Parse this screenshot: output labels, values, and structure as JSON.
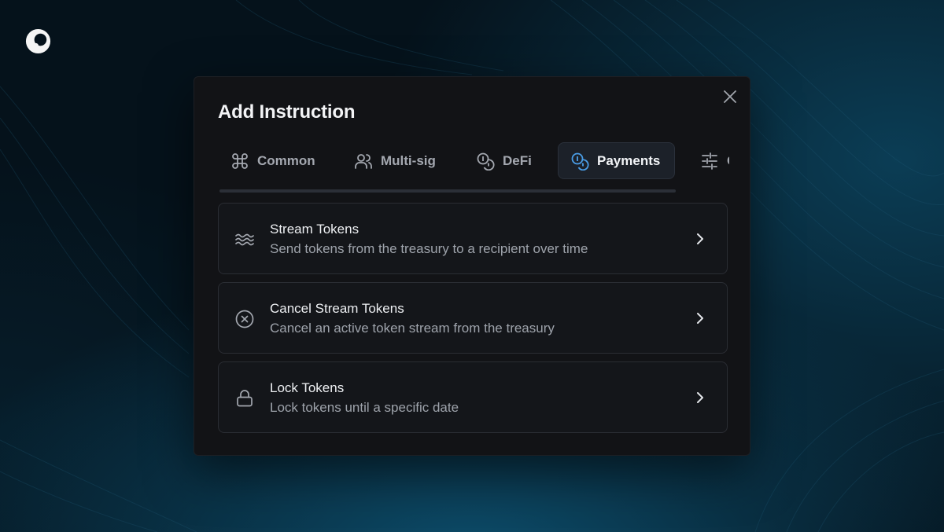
{
  "modal": {
    "title": "Add Instruction",
    "close_icon": "close-icon"
  },
  "tabs": [
    {
      "label": "Common",
      "icon": "command-icon",
      "active": false
    },
    {
      "label": "Multi-sig",
      "icon": "users-icon",
      "active": false
    },
    {
      "label": "DeFi",
      "icon": "coins-icon",
      "active": false
    },
    {
      "label": "Payments",
      "icon": "coins-icon",
      "active": true
    },
    {
      "label": "C",
      "icon": "sliders-icon",
      "active": false
    }
  ],
  "items": [
    {
      "title": "Stream Tokens",
      "description": "Send tokens from the treasury to a recipient over time",
      "icon": "waves-icon"
    },
    {
      "title": "Cancel Stream Tokens",
      "description": "Cancel an active token stream from the treasury",
      "icon": "x-circle-icon"
    },
    {
      "title": "Lock Tokens",
      "description": "Lock tokens until a specific date",
      "icon": "lock-icon"
    }
  ],
  "colors": {
    "accent": "#4a9ee8",
    "modal_bg": "#121316",
    "background": "#05121b"
  }
}
